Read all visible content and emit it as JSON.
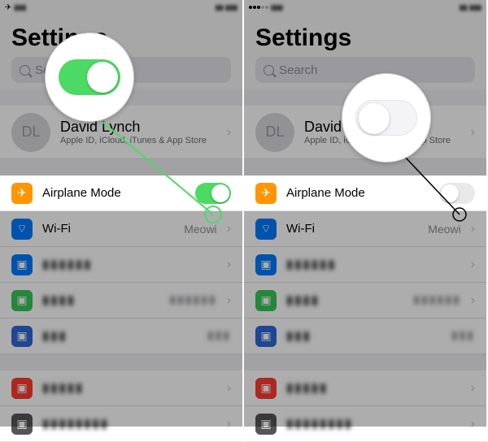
{
  "left": {
    "title": "Settings",
    "search_placeholder": "Search",
    "profile": {
      "initials": "DL",
      "name": "David Lynch",
      "sub": "Apple ID, iCloud, iTunes & App Store"
    },
    "rows": {
      "airplane": {
        "label": "Airplane Mode",
        "on": true
      },
      "wifi": {
        "label": "Wi-Fi",
        "value": "Meowi"
      }
    }
  },
  "right": {
    "title": "Settings",
    "search_placeholder": "Search",
    "profile": {
      "initials": "DL",
      "name": "David Lynch",
      "sub": "Apple ID, iCloud, iTunes & App Store"
    },
    "rows": {
      "airplane": {
        "label": "Airplane Mode",
        "on": false
      },
      "wifi": {
        "label": "Wi-Fi",
        "value": "Meowi"
      }
    }
  }
}
